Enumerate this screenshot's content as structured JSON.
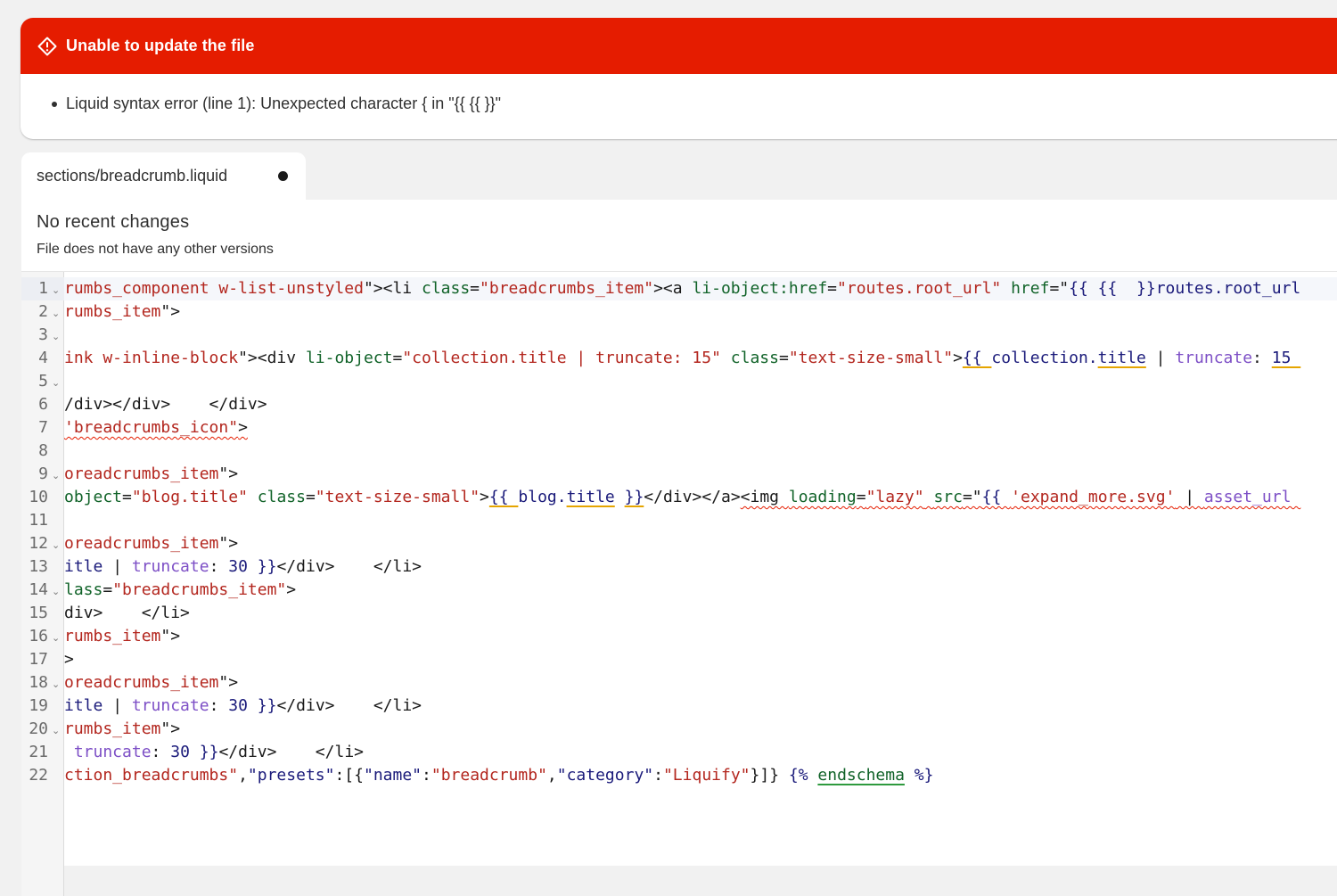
{
  "error": {
    "title": "Unable to update the file",
    "messages": [
      "Liquid syntax error (line 1): Unexpected character { in \"{{ {{ }}\""
    ],
    "color": "#e51c00"
  },
  "tab": {
    "path_prefix": "sections/",
    "filename": "breadcrumb.liquid",
    "unsaved": true
  },
  "versions": {
    "heading": "No recent changes",
    "subtext": "File does not have any other versions"
  },
  "code_lines": [
    {
      "number": "1",
      "foldable": true,
      "tokens": [
        {
          "t": "rumbs_component w-list-unstyled",
          "c": "t-str"
        },
        {
          "t": "\"><li ",
          "c": "t-tag"
        },
        {
          "t": "class",
          "c": "t-attr"
        },
        {
          "t": "=",
          "c": "t-tag"
        },
        {
          "t": "\"breadcrumbs_item\"",
          "c": "t-str"
        },
        {
          "t": "><a ",
          "c": "t-tag"
        },
        {
          "t": "li-object:href",
          "c": "t-attr"
        },
        {
          "t": "=",
          "c": "t-tag"
        },
        {
          "t": "\"routes.root_url\"",
          "c": "t-str"
        },
        {
          "t": " ",
          "c": "t-tag"
        },
        {
          "t": "href",
          "c": "t-attr"
        },
        {
          "t": "=\"",
          "c": "t-tag"
        },
        {
          "t": "{{ {{  }}",
          "c": "t-liq"
        },
        {
          "t": "routes.root_url",
          "c": "t-var"
        }
      ]
    },
    {
      "number": "2",
      "foldable": true,
      "tokens": [
        {
          "t": "rumbs_item",
          "c": "t-str"
        },
        {
          "t": "\">",
          "c": "t-tag"
        }
      ]
    },
    {
      "number": "3",
      "foldable": true,
      "tokens": []
    },
    {
      "number": "4",
      "foldable": false,
      "tokens": [
        {
          "t": "ink w-inline-block",
          "c": "t-str"
        },
        {
          "t": "\"><div ",
          "c": "t-tag"
        },
        {
          "t": "li-object",
          "c": "t-attr"
        },
        {
          "t": "=",
          "c": "t-tag"
        },
        {
          "t": "\"collection.title | truncate: 15\"",
          "c": "t-str"
        },
        {
          "t": " ",
          "c": "t-tag"
        },
        {
          "t": "class",
          "c": "t-attr"
        },
        {
          "t": "=",
          "c": "t-tag"
        },
        {
          "t": "\"text-size-small\"",
          "c": "t-str"
        },
        {
          "t": ">",
          "c": "t-tag"
        },
        {
          "t": "{{ ",
          "c": "t-liq warn"
        },
        {
          "t": "collection.",
          "c": "t-var"
        },
        {
          "t": "title",
          "c": "t-var warn"
        },
        {
          "t": " | ",
          "c": "t-tag"
        },
        {
          "t": "truncate",
          "c": "t-filter"
        },
        {
          "t": ": ",
          "c": "t-tag"
        },
        {
          "t": "15 ",
          "c": "t-num warn"
        }
      ]
    },
    {
      "number": "5",
      "foldable": true,
      "tokens": []
    },
    {
      "number": "6",
      "foldable": false,
      "tokens": [
        {
          "t": "/div></div>    </div>",
          "c": "t-tag"
        }
      ]
    },
    {
      "number": "7",
      "foldable": false,
      "tokens": [
        {
          "t": "'breadcrumbs_icon\"",
          "c": "t-str err"
        },
        {
          "t": ">",
          "c": "t-tag err"
        }
      ]
    },
    {
      "number": "8",
      "foldable": false,
      "tokens": []
    },
    {
      "number": "9",
      "foldable": true,
      "tokens": [
        {
          "t": "oreadcrumbs_item",
          "c": "t-str"
        },
        {
          "t": "\">",
          "c": "t-tag"
        }
      ]
    },
    {
      "number": "10",
      "foldable": false,
      "tokens": [
        {
          "t": "object",
          "c": "t-attr"
        },
        {
          "t": "=",
          "c": "t-tag"
        },
        {
          "t": "\"blog.title\"",
          "c": "t-str"
        },
        {
          "t": " ",
          "c": "t-tag"
        },
        {
          "t": "class",
          "c": "t-attr"
        },
        {
          "t": "=",
          "c": "t-tag"
        },
        {
          "t": "\"text-size-small\"",
          "c": "t-str"
        },
        {
          "t": ">",
          "c": "t-tag"
        },
        {
          "t": "{{ ",
          "c": "t-liq warn"
        },
        {
          "t": "blog.",
          "c": "t-var"
        },
        {
          "t": "title",
          "c": "t-var warn"
        },
        {
          "t": " ",
          "c": "t-tag"
        },
        {
          "t": "}}",
          "c": "t-liq warn"
        },
        {
          "t": "</div></a>",
          "c": "t-tag"
        },
        {
          "t": "<img ",
          "c": "t-tag err"
        },
        {
          "t": "loading",
          "c": "t-attr err"
        },
        {
          "t": "=",
          "c": "t-tag err"
        },
        {
          "t": "\"lazy\"",
          "c": "t-str err"
        },
        {
          "t": " ",
          "c": "t-tag err"
        },
        {
          "t": "src",
          "c": "t-attr err"
        },
        {
          "t": "=\"",
          "c": "t-tag err"
        },
        {
          "t": "{{ ",
          "c": "t-liq err"
        },
        {
          "t": "'expand_more.svg'",
          "c": "t-str err"
        },
        {
          "t": " | ",
          "c": "t-tag err"
        },
        {
          "t": "asset_url ",
          "c": "t-filter err"
        }
      ]
    },
    {
      "number": "11",
      "foldable": false,
      "tokens": []
    },
    {
      "number": "12",
      "foldable": true,
      "tokens": [
        {
          "t": "oreadcrumbs_item",
          "c": "t-str"
        },
        {
          "t": "\">",
          "c": "t-tag"
        }
      ]
    },
    {
      "number": "13",
      "foldable": false,
      "tokens": [
        {
          "t": "itle",
          "c": "t-var"
        },
        {
          "t": " | ",
          "c": "t-tag"
        },
        {
          "t": "truncate",
          "c": "t-filter"
        },
        {
          "t": ": ",
          "c": "t-tag"
        },
        {
          "t": "30",
          "c": "t-num"
        },
        {
          "t": " }}",
          "c": "t-liq"
        },
        {
          "t": "</div>    </li>",
          "c": "t-tag"
        }
      ]
    },
    {
      "number": "14",
      "foldable": true,
      "tokens": [
        {
          "t": "lass",
          "c": "t-attr"
        },
        {
          "t": "=",
          "c": "t-tag"
        },
        {
          "t": "\"breadcrumbs_item\"",
          "c": "t-str"
        },
        {
          "t": ">",
          "c": "t-tag"
        }
      ]
    },
    {
      "number": "15",
      "foldable": false,
      "tokens": [
        {
          "t": "div>    </li>",
          "c": "t-tag"
        }
      ]
    },
    {
      "number": "16",
      "foldable": true,
      "tokens": [
        {
          "t": "rumbs_item",
          "c": "t-str"
        },
        {
          "t": "\">",
          "c": "t-tag"
        }
      ]
    },
    {
      "number": "17",
      "foldable": false,
      "tokens": [
        {
          "t": ">",
          "c": "t-tag"
        }
      ]
    },
    {
      "number": "18",
      "foldable": true,
      "tokens": [
        {
          "t": "oreadcrumbs_item",
          "c": "t-str"
        },
        {
          "t": "\">",
          "c": "t-tag"
        }
      ]
    },
    {
      "number": "19",
      "foldable": false,
      "tokens": [
        {
          "t": "itle",
          "c": "t-var"
        },
        {
          "t": " | ",
          "c": "t-tag"
        },
        {
          "t": "truncate",
          "c": "t-filter"
        },
        {
          "t": ": ",
          "c": "t-tag"
        },
        {
          "t": "30",
          "c": "t-num"
        },
        {
          "t": " }}",
          "c": "t-liq"
        },
        {
          "t": "</div>    </li>",
          "c": "t-tag"
        }
      ]
    },
    {
      "number": "20",
      "foldable": true,
      "tokens": [
        {
          "t": "rumbs_item",
          "c": "t-str"
        },
        {
          "t": "\">",
          "c": "t-tag"
        }
      ]
    },
    {
      "number": "21",
      "foldable": false,
      "tokens": [
        {
          "t": " truncate",
          "c": "t-filter"
        },
        {
          "t": ": ",
          "c": "t-tag"
        },
        {
          "t": "30",
          "c": "t-num"
        },
        {
          "t": " }}",
          "c": "t-liq"
        },
        {
          "t": "</div>    </li>",
          "c": "t-tag"
        }
      ]
    },
    {
      "number": "22",
      "foldable": false,
      "tokens": [
        {
          "t": "ction_breadcrumbs\"",
          "c": "t-str"
        },
        {
          "t": ",",
          "c": "t-tag"
        },
        {
          "t": "\"presets\"",
          "c": "t-key"
        },
        {
          "t": ":[{",
          "c": "t-tag"
        },
        {
          "t": "\"name\"",
          "c": "t-key"
        },
        {
          "t": ":",
          "c": "t-tag"
        },
        {
          "t": "\"breadcrumb\"",
          "c": "t-str"
        },
        {
          "t": ",",
          "c": "t-tag"
        },
        {
          "t": "\"category\"",
          "c": "t-key"
        },
        {
          "t": ":",
          "c": "t-tag"
        },
        {
          "t": "\"Liquify\"",
          "c": "t-str"
        },
        {
          "t": "}]} ",
          "c": "t-tag"
        },
        {
          "t": "{% ",
          "c": "t-liq"
        },
        {
          "t": "endschema",
          "c": "t-kw ok"
        },
        {
          "t": " %}",
          "c": "t-liq"
        }
      ]
    }
  ]
}
